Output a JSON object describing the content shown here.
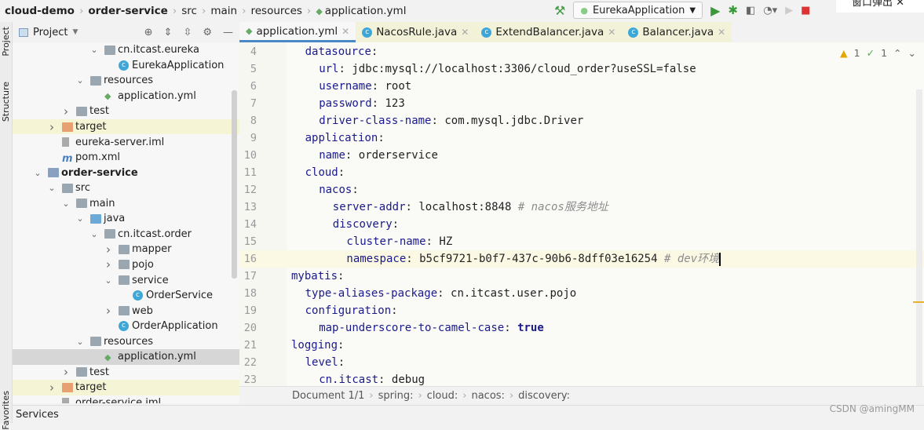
{
  "breadcrumb": [
    {
      "label": "cloud-demo",
      "bold": true
    },
    {
      "label": "order-service",
      "bold": true
    },
    {
      "label": "src"
    },
    {
      "label": "main"
    },
    {
      "label": "resources"
    },
    {
      "label": "application.yml"
    }
  ],
  "run_config": "EurekaApplication",
  "popup_text": "窗口弹出",
  "panel": {
    "title": "Project"
  },
  "side_stripe": {
    "project": "Project",
    "structure": "Structure",
    "favorites": "Favorites"
  },
  "tree": [
    {
      "label": "cn.itcast.eureka",
      "level": 5,
      "type": "package",
      "expanded": true
    },
    {
      "label": "EurekaApplication",
      "level": 6,
      "type": "class"
    },
    {
      "label": "resources",
      "level": 4,
      "type": "folder",
      "expanded": true
    },
    {
      "label": "application.yml",
      "level": 5,
      "type": "yml"
    },
    {
      "label": "test",
      "level": 3,
      "type": "folder",
      "expanded": false
    },
    {
      "label": "target",
      "level": 2,
      "type": "folder-orange",
      "expanded": false,
      "highlight": true
    },
    {
      "label": "eureka-server.iml",
      "level": 2,
      "type": "file"
    },
    {
      "label": "pom.xml",
      "level": 2,
      "type": "maven"
    },
    {
      "label": "order-service",
      "level": 1,
      "type": "module",
      "expanded": true,
      "bold": true
    },
    {
      "label": "src",
      "level": 2,
      "type": "folder",
      "expanded": true
    },
    {
      "label": "main",
      "level": 3,
      "type": "folder",
      "expanded": true
    },
    {
      "label": "java",
      "level": 4,
      "type": "folder-blue",
      "expanded": true
    },
    {
      "label": "cn.itcast.order",
      "level": 5,
      "type": "package",
      "expanded": true
    },
    {
      "label": "mapper",
      "level": 6,
      "type": "package",
      "expanded": false
    },
    {
      "label": "pojo",
      "level": 6,
      "type": "package",
      "expanded": false
    },
    {
      "label": "service",
      "level": 6,
      "type": "package",
      "expanded": true
    },
    {
      "label": "OrderService",
      "level": 7,
      "type": "class"
    },
    {
      "label": "web",
      "level": 6,
      "type": "package",
      "expanded": false
    },
    {
      "label": "OrderApplication",
      "level": 6,
      "type": "class"
    },
    {
      "label": "resources",
      "level": 4,
      "type": "folder",
      "expanded": true
    },
    {
      "label": "application.yml",
      "level": 5,
      "type": "yml",
      "selected": true
    },
    {
      "label": "test",
      "level": 3,
      "type": "folder",
      "expanded": false
    },
    {
      "label": "target",
      "level": 2,
      "type": "folder-orange",
      "expanded": false,
      "highlight": true
    },
    {
      "label": "order-service.iml",
      "level": 2,
      "type": "file"
    }
  ],
  "tabs": [
    {
      "label": "application.yml",
      "icon": "yml",
      "active": true
    },
    {
      "label": "NacosRule.java",
      "icon": "class"
    },
    {
      "label": "ExtendBalancer.java",
      "icon": "class"
    },
    {
      "label": "Balancer.java",
      "icon": "class"
    }
  ],
  "inspections": {
    "warnings": "1",
    "weak": "1"
  },
  "code": [
    {
      "n": "4",
      "indent": 1,
      "key": "datasource",
      "val": ""
    },
    {
      "n": "5",
      "indent": 2,
      "key": "url",
      "val": "jdbc:mysql://localhost:3306/cloud_order?useSSL=false"
    },
    {
      "n": "6",
      "indent": 2,
      "key": "username",
      "val": "root"
    },
    {
      "n": "7",
      "indent": 2,
      "key": "password",
      "val": "123"
    },
    {
      "n": "8",
      "indent": 2,
      "key": "driver-class-name",
      "val": "com.mysql.jdbc.Driver"
    },
    {
      "n": "9",
      "indent": 1,
      "key": "application",
      "val": ""
    },
    {
      "n": "10",
      "indent": 2,
      "key": "name",
      "val": "orderservice"
    },
    {
      "n": "11",
      "indent": 1,
      "key": "cloud",
      "val": ""
    },
    {
      "n": "12",
      "indent": 2,
      "key": "nacos",
      "val": ""
    },
    {
      "n": "13",
      "indent": 3,
      "key": "server-addr",
      "val": "localhost:8848",
      "comment": "# nacos服务地址"
    },
    {
      "n": "14",
      "indent": 3,
      "key": "discovery",
      "val": ""
    },
    {
      "n": "15",
      "indent": 4,
      "key": "cluster-name",
      "val": "HZ"
    },
    {
      "n": "16",
      "indent": 4,
      "key": "namespace",
      "val": "b5cf9721-b0f7-437c-90b6-8dff03e16254",
      "comment": "# dev环境",
      "current": true
    },
    {
      "n": "17",
      "indent": 0,
      "key": "mybatis",
      "val": ""
    },
    {
      "n": "18",
      "indent": 1,
      "key": "type-aliases-package",
      "val": "cn.itcast.user.pojo"
    },
    {
      "n": "19",
      "indent": 1,
      "key": "configuration",
      "val": ""
    },
    {
      "n": "20",
      "indent": 2,
      "key": "map-underscore-to-camel-case",
      "val": "true",
      "bool": true
    },
    {
      "n": "21",
      "indent": 0,
      "key": "logging",
      "val": ""
    },
    {
      "n": "22",
      "indent": 1,
      "key": "level",
      "val": ""
    },
    {
      "n": "23",
      "indent": 2,
      "key": "cn.itcast",
      "val": "debug"
    }
  ],
  "status_path": [
    "Document 1/1",
    "spring:",
    "cloud:",
    "nacos:",
    "discovery:"
  ],
  "bottom": {
    "services": "Services"
  },
  "watermark": "CSDN @amingMM"
}
